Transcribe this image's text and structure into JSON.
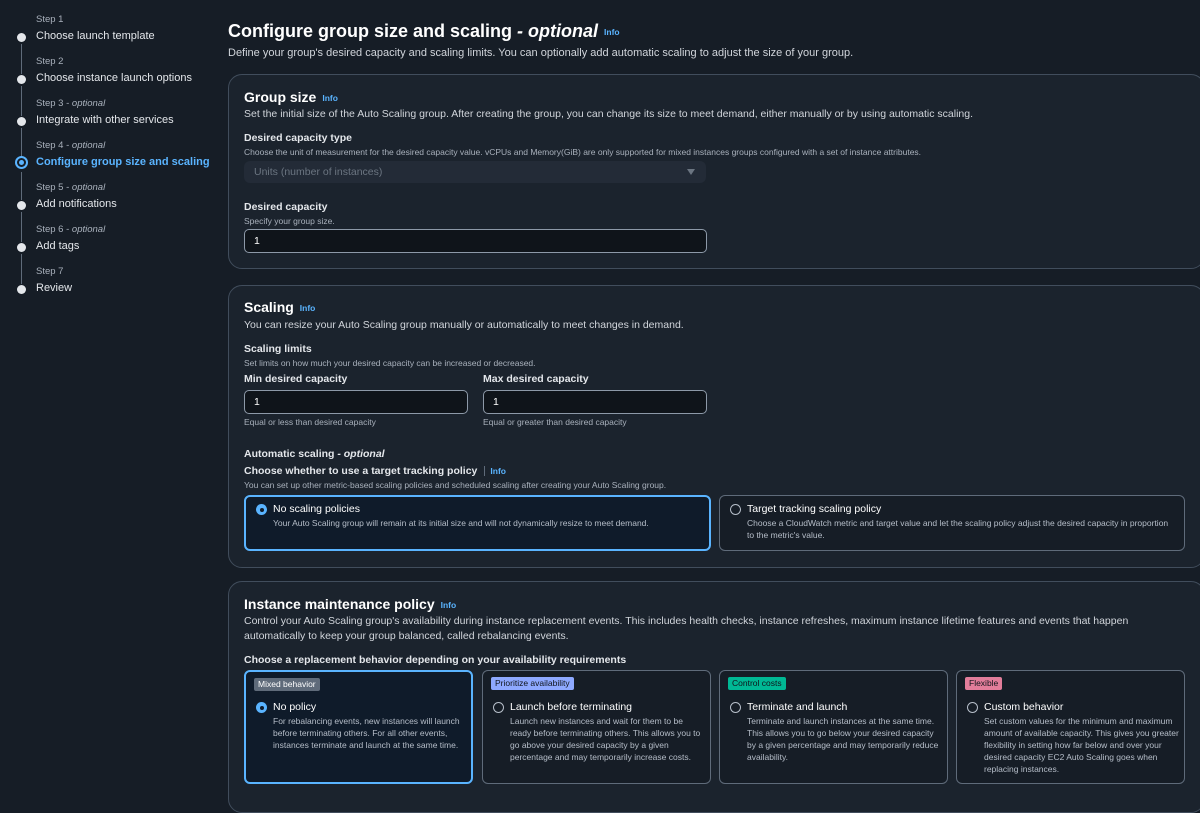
{
  "steps": [
    {
      "num": "Step 1",
      "optional": "",
      "label": "Choose launch template"
    },
    {
      "num": "Step 2",
      "optional": "",
      "label": "Choose instance launch options"
    },
    {
      "num": "Step 3",
      "optional": "optional",
      "label": "Integrate with other services"
    },
    {
      "num": "Step 4",
      "optional": "optional",
      "label": "Configure group size and scaling"
    },
    {
      "num": "Step 5",
      "optional": "optional",
      "label": "Add notifications"
    },
    {
      "num": "Step 6",
      "optional": "optional",
      "label": "Add tags"
    },
    {
      "num": "Step 7",
      "optional": "",
      "label": "Review"
    }
  ],
  "step_optional_sep": " - ",
  "page": {
    "title": "Configure group size and scaling",
    "title_suffix": " - optional",
    "info": "Info",
    "desc": "Define your group's desired capacity and scaling limits. You can optionally add automatic scaling to adjust the size of your group."
  },
  "group_size": {
    "title": "Group size",
    "info": "Info",
    "desc": "Set the initial size of the Auto Scaling group. After creating the group, you can change its size to meet demand, either manually or by using automatic scaling.",
    "capacity_type_label": "Desired capacity type",
    "capacity_type_desc": "Choose the unit of measurement for the desired capacity value. vCPUs and Memory(GiB) are only supported for mixed instances groups configured with a set of instance attributes.",
    "capacity_type_value": "Units (number of instances)",
    "capacity_label": "Desired capacity",
    "capacity_desc": "Specify your group size.",
    "capacity_value": "1"
  },
  "scaling": {
    "title": "Scaling",
    "info": "Info",
    "desc": "You can resize your Auto Scaling group manually or automatically to meet changes in demand.",
    "limits_label": "Scaling limits",
    "limits_desc": "Set limits on how much your desired capacity can be increased or decreased.",
    "min_label": "Min desired capacity",
    "min_value": "1",
    "min_hint": "Equal or less than desired capacity",
    "max_label": "Max desired capacity",
    "max_value": "1",
    "max_hint": "Equal or greater than desired capacity",
    "auto_label": "Automatic scaling",
    "auto_optional": " - optional",
    "tracking_label": "Choose whether to use a target tracking policy",
    "tracking_info": "Info",
    "tracking_desc": "You can set up other metric-based scaling policies and scheduled scaling after creating your Auto Scaling group.",
    "options": [
      {
        "title": "No scaling policies",
        "desc": "Your Auto Scaling group will remain at its initial size and will not dynamically resize to meet demand."
      },
      {
        "title": "Target tracking scaling policy",
        "desc": "Choose a CloudWatch metric and target value and let the scaling policy adjust the desired capacity in proportion to the metric's value."
      }
    ]
  },
  "maintenance": {
    "title": "Instance maintenance policy",
    "info": "Info",
    "desc_line1": "Control your Auto Scaling group's availability during instance replacement events. This includes health checks, instance refreshes, maximum instance lifetime features and events that happen",
    "desc_line2": "automatically to keep your group balanced, called rebalancing events.",
    "choose_label": "Choose a replacement behavior depending on your availability requirements",
    "options": [
      {
        "badge": "Mixed behavior",
        "title": "No policy",
        "desc": "For rebalancing events, new instances will launch before terminating others. For all other events, instances terminate and launch at the same time."
      },
      {
        "badge": "Prioritize availability",
        "title": "Launch before terminating",
        "desc": "Launch new instances and wait for them to be ready before terminating others. This allows you to go above your desired capacity by a given percentage and may temporarily increase costs."
      },
      {
        "badge": "Control costs",
        "title": "Terminate and launch",
        "desc": "Terminate and launch instances at the same time. This allows you to go below your desired capacity by a given percentage and may temporarily reduce availability."
      },
      {
        "badge": "Flexible",
        "title": "Custom behavior",
        "desc": "Set custom values for the minimum and maximum amount of available capacity. This gives you greater flexibility in setting how far below and over your desired capacity EC2 Auto Scaling goes when replacing instances."
      }
    ]
  },
  "colors": {
    "accent": "#5ab4ff",
    "background": "#161d26",
    "card": "#1b232d",
    "border": "#414d5c"
  }
}
